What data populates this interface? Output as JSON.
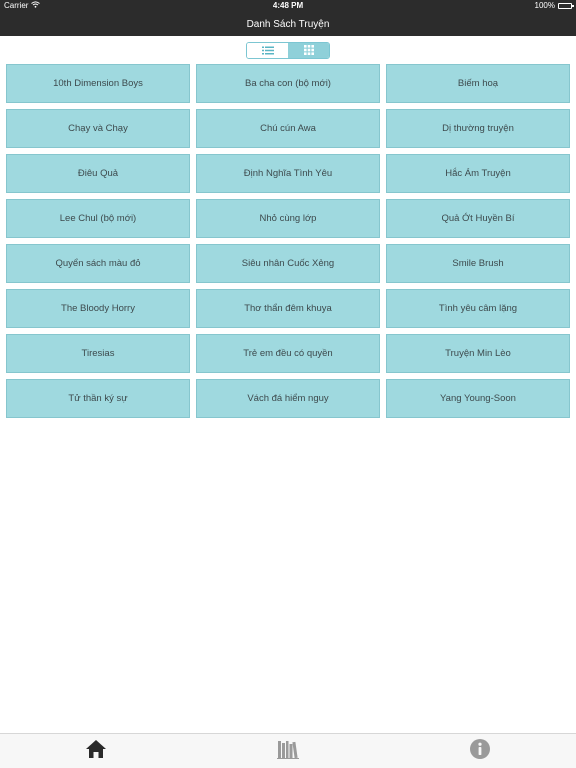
{
  "status_bar": {
    "carrier": "Carrier",
    "time": "4:48 PM",
    "battery": "100%"
  },
  "nav": {
    "title": "Danh Sách Truyện"
  },
  "view_toggle": {
    "options": [
      {
        "icon": "list-icon",
        "selected": false
      },
      {
        "icon": "grid-icon",
        "selected": true
      }
    ]
  },
  "stories": [
    "10th Dimension Boys",
    "Ba cha con (bộ mới)",
    "Biếm hoạ",
    "Chạy và Chạy",
    "Chú cún Awa",
    "Dị thường truyện",
    "Điêu Quả",
    "Định Nghĩa Tình Yêu",
    "Hắc Ám Truyện",
    "Lee Chul (bộ mới)",
    "Nhỏ cùng lớp",
    "Quả Ớt Huyền Bí",
    "Quyển sách màu đỏ",
    "Siêu nhân Cuốc Xẻng",
    "Smile Brush",
    "The Bloody Horry",
    "Thơ thẩn đêm khuya",
    "Tình yêu câm lặng",
    "Tiresias",
    "Trẻ em đều có quyền",
    "Truyện Min Lèo",
    "Tử thần ký sự",
    "Vách đá hiểm nguy",
    "Yang Young-Soon"
  ],
  "tabs": [
    {
      "icon": "home-icon",
      "active": true
    },
    {
      "icon": "library-icon",
      "active": false
    },
    {
      "icon": "info-icon",
      "active": false
    }
  ],
  "colors": {
    "bar_background": "#2c2c2c",
    "cell_background": "#9fd9df",
    "accent": "#7cc6d2"
  }
}
